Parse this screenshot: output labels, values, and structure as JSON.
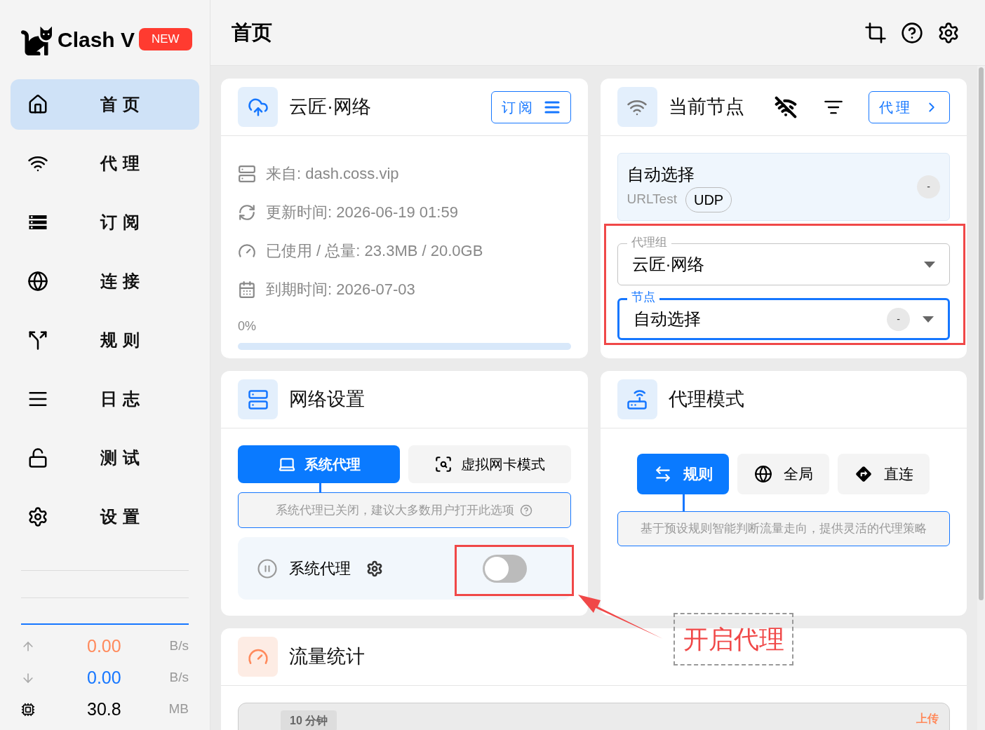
{
  "app": {
    "name": "Clash V",
    "badge": "NEW"
  },
  "nav": [
    {
      "label": "首页",
      "selected": true
    },
    {
      "label": "代理",
      "selected": false
    },
    {
      "label": "订阅",
      "selected": false
    },
    {
      "label": "连接",
      "selected": false
    },
    {
      "label": "规则",
      "selected": false
    },
    {
      "label": "日志",
      "selected": false
    },
    {
      "label": "测试",
      "selected": false
    },
    {
      "label": "设置",
      "selected": false
    }
  ],
  "traffic": [
    {
      "kind": "up",
      "value": "0.00",
      "unit": "B/s"
    },
    {
      "kind": "down",
      "value": "0.00",
      "unit": "B/s"
    },
    {
      "kind": "memory",
      "value": "30.8",
      "unit": "MB"
    }
  ],
  "page_title": "首页",
  "profile": {
    "title": "云匠·网络",
    "button": "订阅",
    "rows": [
      "来自: dash.coss.vip",
      "更新时间: 2026-06-19 01:59",
      "已使用 / 总量: 23.3MB / 20.0GB",
      "到期时间: 2026-07-03"
    ],
    "usage": "0%",
    "level": 0
  },
  "current_node": {
    "title": "当前节点",
    "button": "代理",
    "node": {
      "name": "自动选择",
      "type": "URLTest",
      "tag": "UDP",
      "delay": "-"
    },
    "selects": [
      {
        "label": "代理组",
        "value": "云匠·网络",
        "focused": false
      },
      {
        "label": "节点",
        "value": "自动选择",
        "focused": true,
        "delay": "-"
      }
    ]
  },
  "network": {
    "title": "网络设置",
    "tabs": [
      {
        "label": "系统代理",
        "selected": true
      },
      {
        "label": "虚拟网卡模式",
        "selected": false
      }
    ],
    "hint": "系统代理已关闭，建议大多数用户打开此选项",
    "toggle": {
      "label": "系统代理",
      "on": false
    }
  },
  "proxy_mode": {
    "title": "代理模式",
    "modes": [
      {
        "label": "规则",
        "selected": true
      },
      {
        "label": "全局",
        "selected": false
      },
      {
        "label": "直连",
        "selected": false
      }
    ],
    "hint": "基于预设规则智能判断流量走向，提供灵活的代理策略"
  },
  "traffic_stats": {
    "title": "流量统计",
    "range": "10 分钟",
    "legend": "上传"
  },
  "annotation": {
    "text": "开启代理"
  }
}
